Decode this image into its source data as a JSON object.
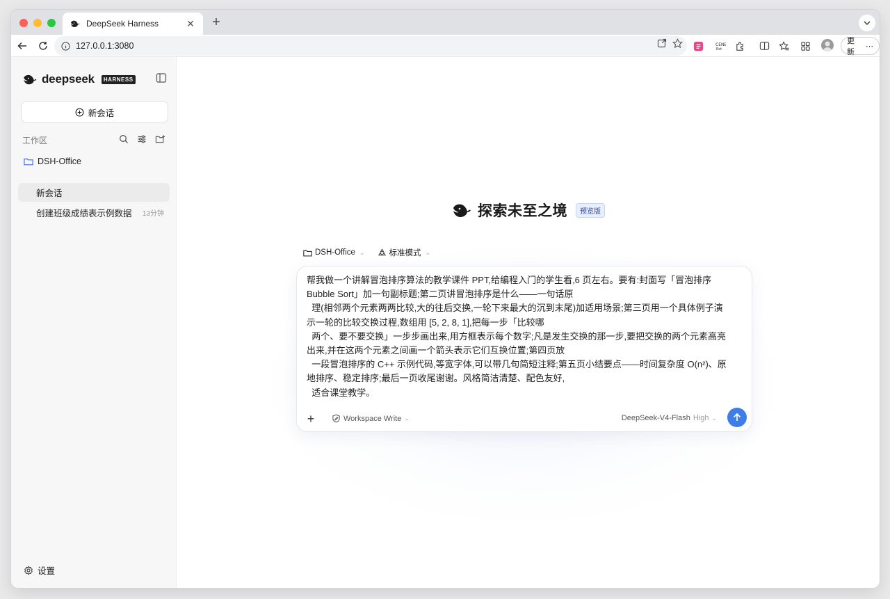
{
  "browser": {
    "tab_title": "DeepSeek Harness",
    "url": "127.0.0.1:3080",
    "update_label": "更新"
  },
  "sidebar": {
    "brand": "deepseek",
    "brand_badge": "HARNESS",
    "new_chat_label": "新会话",
    "workspace_label": "工作区",
    "folder_name": "DSH-Office",
    "conversations": [
      {
        "title": "新会话",
        "time": ""
      },
      {
        "title": "创建班级成绩表示例数据",
        "time": "13分钟"
      }
    ],
    "settings_label": "设置"
  },
  "main": {
    "hero_title": "探索未至之境",
    "hero_badge": "预览版",
    "workspace_selector": "DSH-Office",
    "mode_selector": "标准模式",
    "prompt_text": "帮我做一个讲解冒泡排序算法的教学课件 PPT,给编程入门的学生看,6 页左右。要有:封面写「冒泡排序\nBubble Sort」加一句副标题;第二页讲冒泡排序是什么——一句话原\n  理(相邻两个元素两两比较,大的往后交换,一轮下来最大的沉到末尾)加适用场景;第三页用一个具体例子演\n示一轮的比较交换过程,数组用 [5, 2, 8, 1],把每一步「比较哪\n  两个、要不要交换」一步步画出来,用方框表示每个数字;凡是发生交换的那一步,要把交换的两个元素高亮\n出来,并在这两个元素之间画一个箭头表示它们互换位置;第四页放\n  一段冒泡排序的 C++ 示例代码,等宽字体,可以带几句简短注释;第五页小结要点——时间复杂度 O(n²)、原\n地排序、稳定排序;最后一页收尾谢谢。风格简洁清楚、配色友好,\n  适合课堂教学。",
    "permission_label": "Workspace Write",
    "model_label": "DeepSeek-V4-Flash",
    "model_level": "High"
  },
  "colors": {
    "accent": "#3f7de8",
    "badge_bg": "#e8eefb",
    "folder_icon": "#3b6fd6"
  }
}
